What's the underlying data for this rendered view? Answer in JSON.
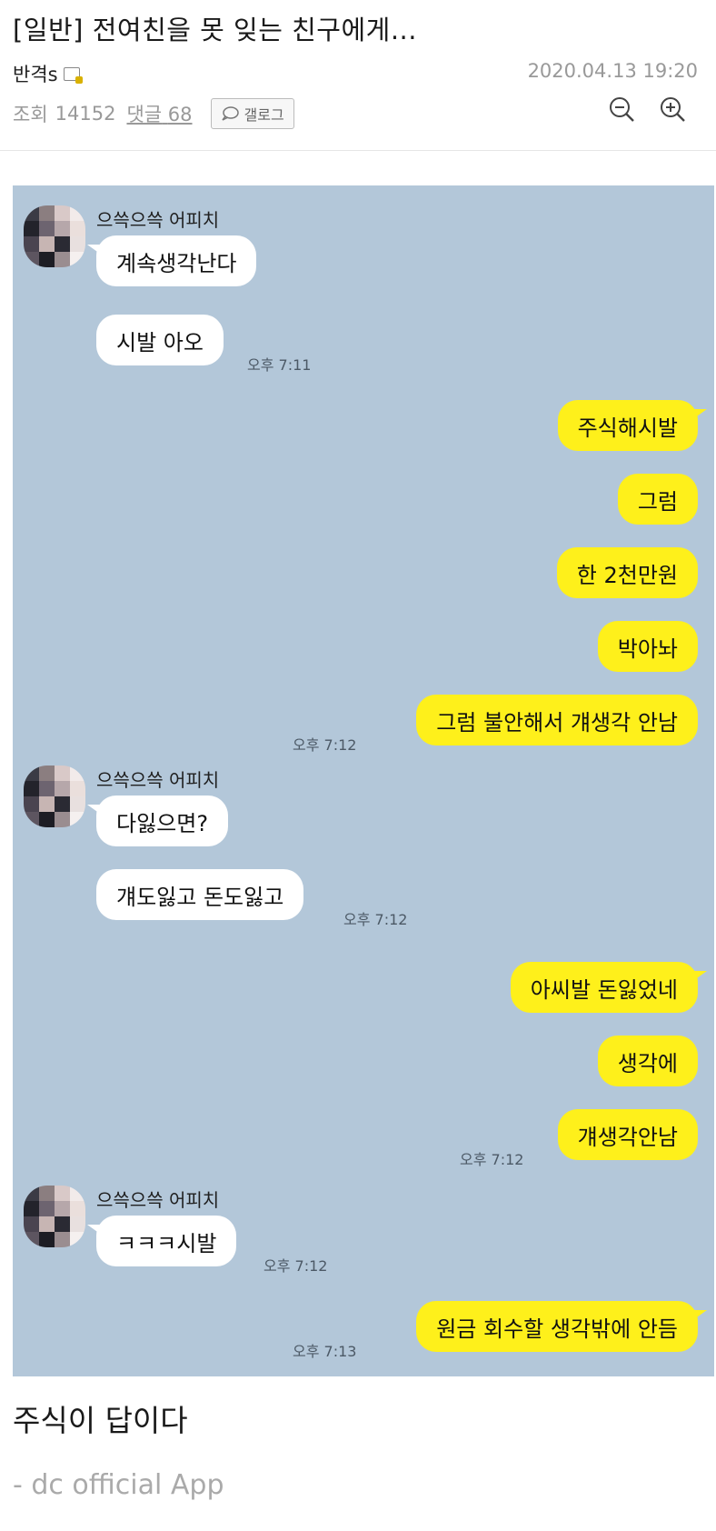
{
  "post": {
    "title": "[일반] 전여친을 못 잊는 친구에게...",
    "author": "반격s",
    "date": "2020.04.13 19:20",
    "views_label": "조회",
    "views": "14152",
    "comments_label": "댓글",
    "comments": "68",
    "gallog_label": "갤로그"
  },
  "chat": {
    "sender_name": "으쓱으쓱 어피치",
    "messages": [
      "계속생각난다",
      "시발 아오",
      "주식해시발",
      "그럼",
      "한 2천만원",
      "박아놔",
      "그럼 불안해서 걔생각 안남",
      "다잃으면?",
      "걔도잃고 돈도잃고",
      "아씨발 돈잃었네",
      "생각에",
      "걔생각안남",
      "ㅋㅋㅋ시발",
      "원금 회수할 생각밖에 안듬"
    ],
    "times": [
      "오후 7:11",
      "오후 7:12",
      "오후 7:12",
      "오후 7:12",
      "오후 7:12",
      "오후 7:13"
    ]
  },
  "body_text": "주식이 답이다",
  "app_tag": "- dc official App",
  "icons": {
    "zoom_out": "zoom-out-icon",
    "zoom_in": "zoom-in-icon",
    "gallog": "speech-bubble-icon",
    "author_badge": "fixed-nick-badge-icon"
  },
  "colors": {
    "chat_background": "#b3c7d9",
    "outgoing_bubble": "#fef01b",
    "incoming_bubble": "#ffffff"
  }
}
